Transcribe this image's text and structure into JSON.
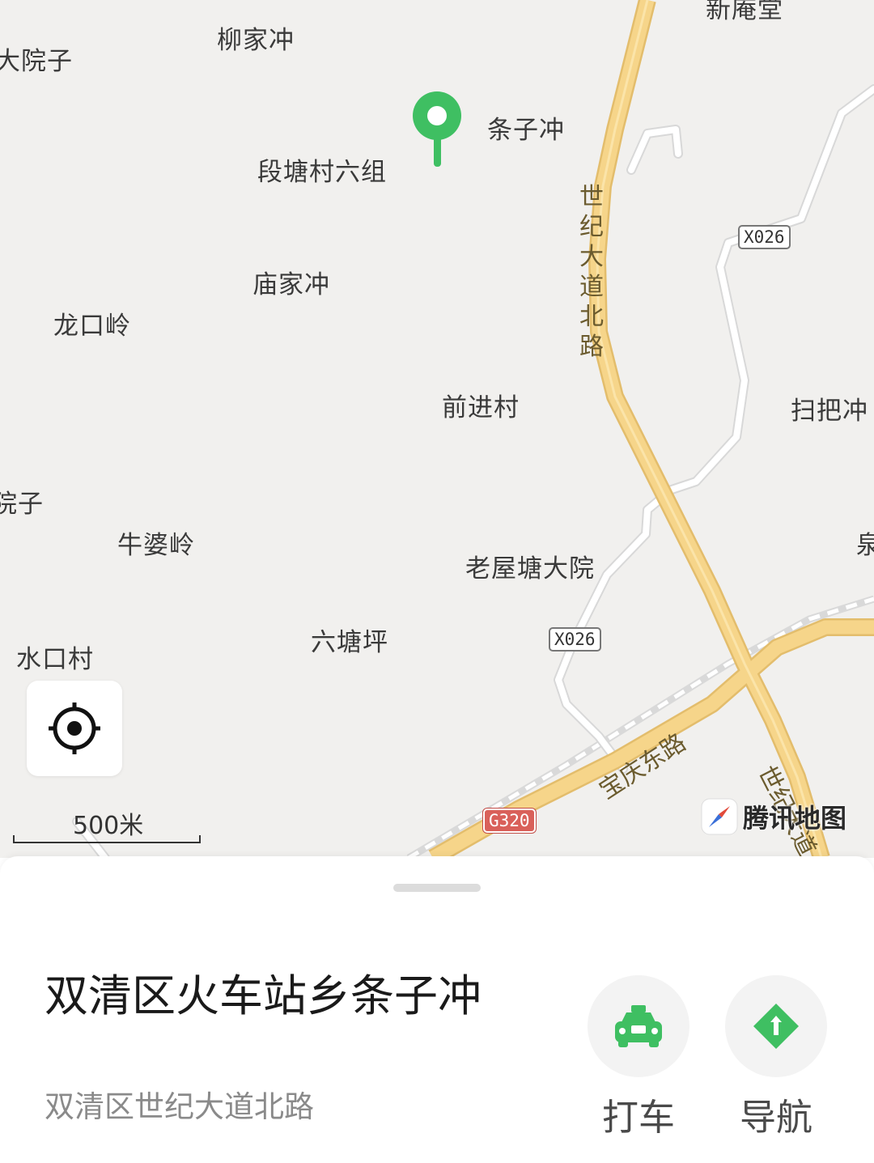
{
  "map": {
    "places": [
      {
        "id": "xinanyu",
        "name": "新庵堂"
      },
      {
        "id": "liujiachong",
        "name": "柳家冲"
      },
      {
        "id": "dayuanzi",
        "name": "大院子"
      },
      {
        "id": "tiaozichong",
        "name": "条子冲"
      },
      {
        "id": "duantang",
        "name": "段塘村六组"
      },
      {
        "id": "miaojiachong",
        "name": "庙家冲"
      },
      {
        "id": "longkouling",
        "name": "龙口岭"
      },
      {
        "id": "qianjincun",
        "name": "前进村"
      },
      {
        "id": "saobachong",
        "name": "扫把冲"
      },
      {
        "id": "yuanzi",
        "name": "院子"
      },
      {
        "id": "niupoling",
        "name": "牛婆岭"
      },
      {
        "id": "quan",
        "name": "泉"
      },
      {
        "id": "laowutang",
        "name": "老屋塘大院"
      },
      {
        "id": "liutangping",
        "name": "六塘坪"
      },
      {
        "id": "shuikoucun",
        "name": "水口村"
      }
    ],
    "road_labels": {
      "shiji_north": "世纪大道北路",
      "shiji_south": "世纪大道",
      "baoqing_east": "宝庆东路"
    },
    "shields": {
      "x026_top": "X026",
      "x026_mid": "X026",
      "g320": "G320"
    },
    "scale_label": "500米",
    "brand": "腾讯地图",
    "colors": {
      "land": "#f1f0ee",
      "major_road": "#f6d58a",
      "minor_road": "#ffffff",
      "pin": "#3fbf62"
    }
  },
  "sheet": {
    "title": "双清区火车站乡条子冲",
    "address": "双清区世纪大道北路",
    "actions": [
      {
        "label": "打车",
        "icon": "taxi-icon"
      },
      {
        "label": "导航",
        "icon": "navigation-icon"
      }
    ],
    "accent": "#3fbf62"
  }
}
